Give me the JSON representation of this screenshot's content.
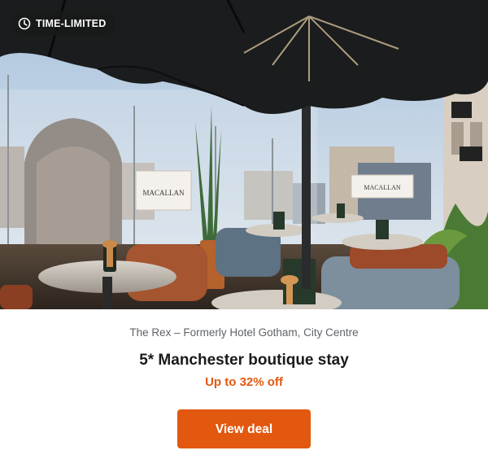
{
  "badge": {
    "label": "TIME-LIMITED",
    "icon": "clock-icon"
  },
  "hero": {
    "description_sign": "The MACALLAN"
  },
  "deal": {
    "location": "The Rex – Formerly Hotel Gotham, City Centre",
    "title": "5* Manchester boutique stay",
    "offer": "Up to 32% off",
    "cta_label": "View deal"
  },
  "colors": {
    "accent": "#e2580f",
    "badge_bg": "#181818"
  }
}
